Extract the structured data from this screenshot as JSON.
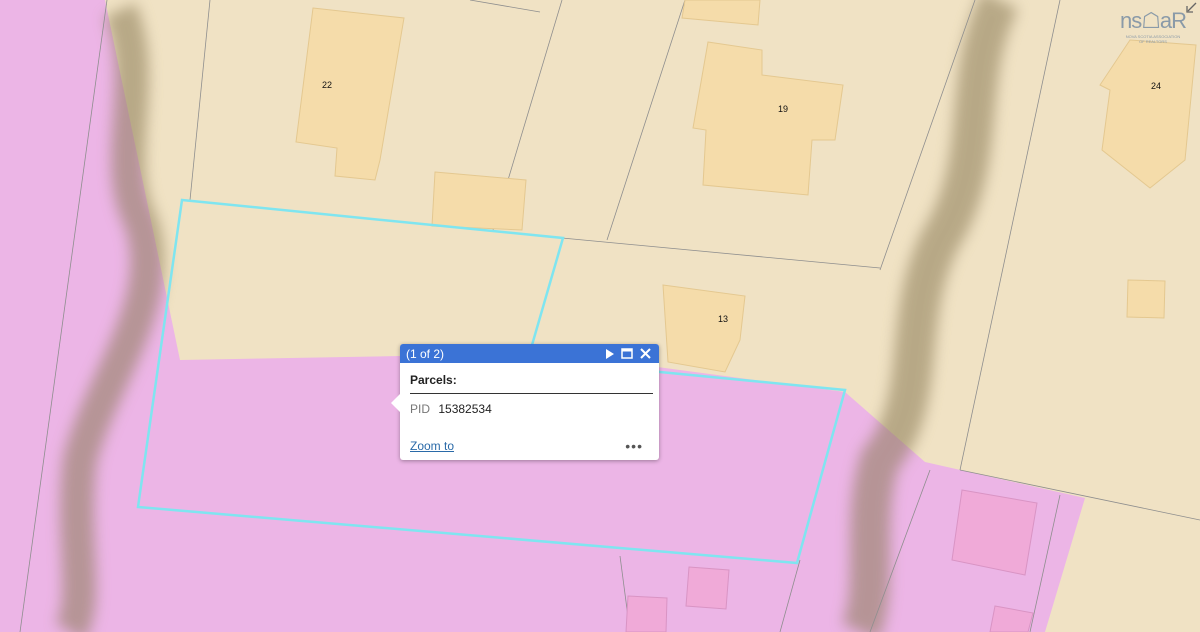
{
  "parcel_labels": [
    "22",
    "19",
    "24",
    "13"
  ],
  "colors": {
    "residential": "#f0e2c4",
    "commercial": "#ecb5e6",
    "building": "#f5dcaa",
    "building_pink": "#f0aad8",
    "selection": "#7fe5f0",
    "popup_header": "#3b73d6"
  },
  "popup": {
    "title": "(1 of 2)",
    "layer": "Parcels:",
    "attr_key": "PID",
    "attr_value": "15382534",
    "zoom_label": "Zoom to",
    "more_label": "•••",
    "next_icon": "play-next-icon",
    "maximize_icon": "maximize-icon",
    "close_icon": "close-icon"
  },
  "logo": {
    "word": "ns☖aR",
    "subtitle_1": "NOVA SCOTIA ASSOCIATION",
    "subtitle_2": "OF REALTORS"
  }
}
